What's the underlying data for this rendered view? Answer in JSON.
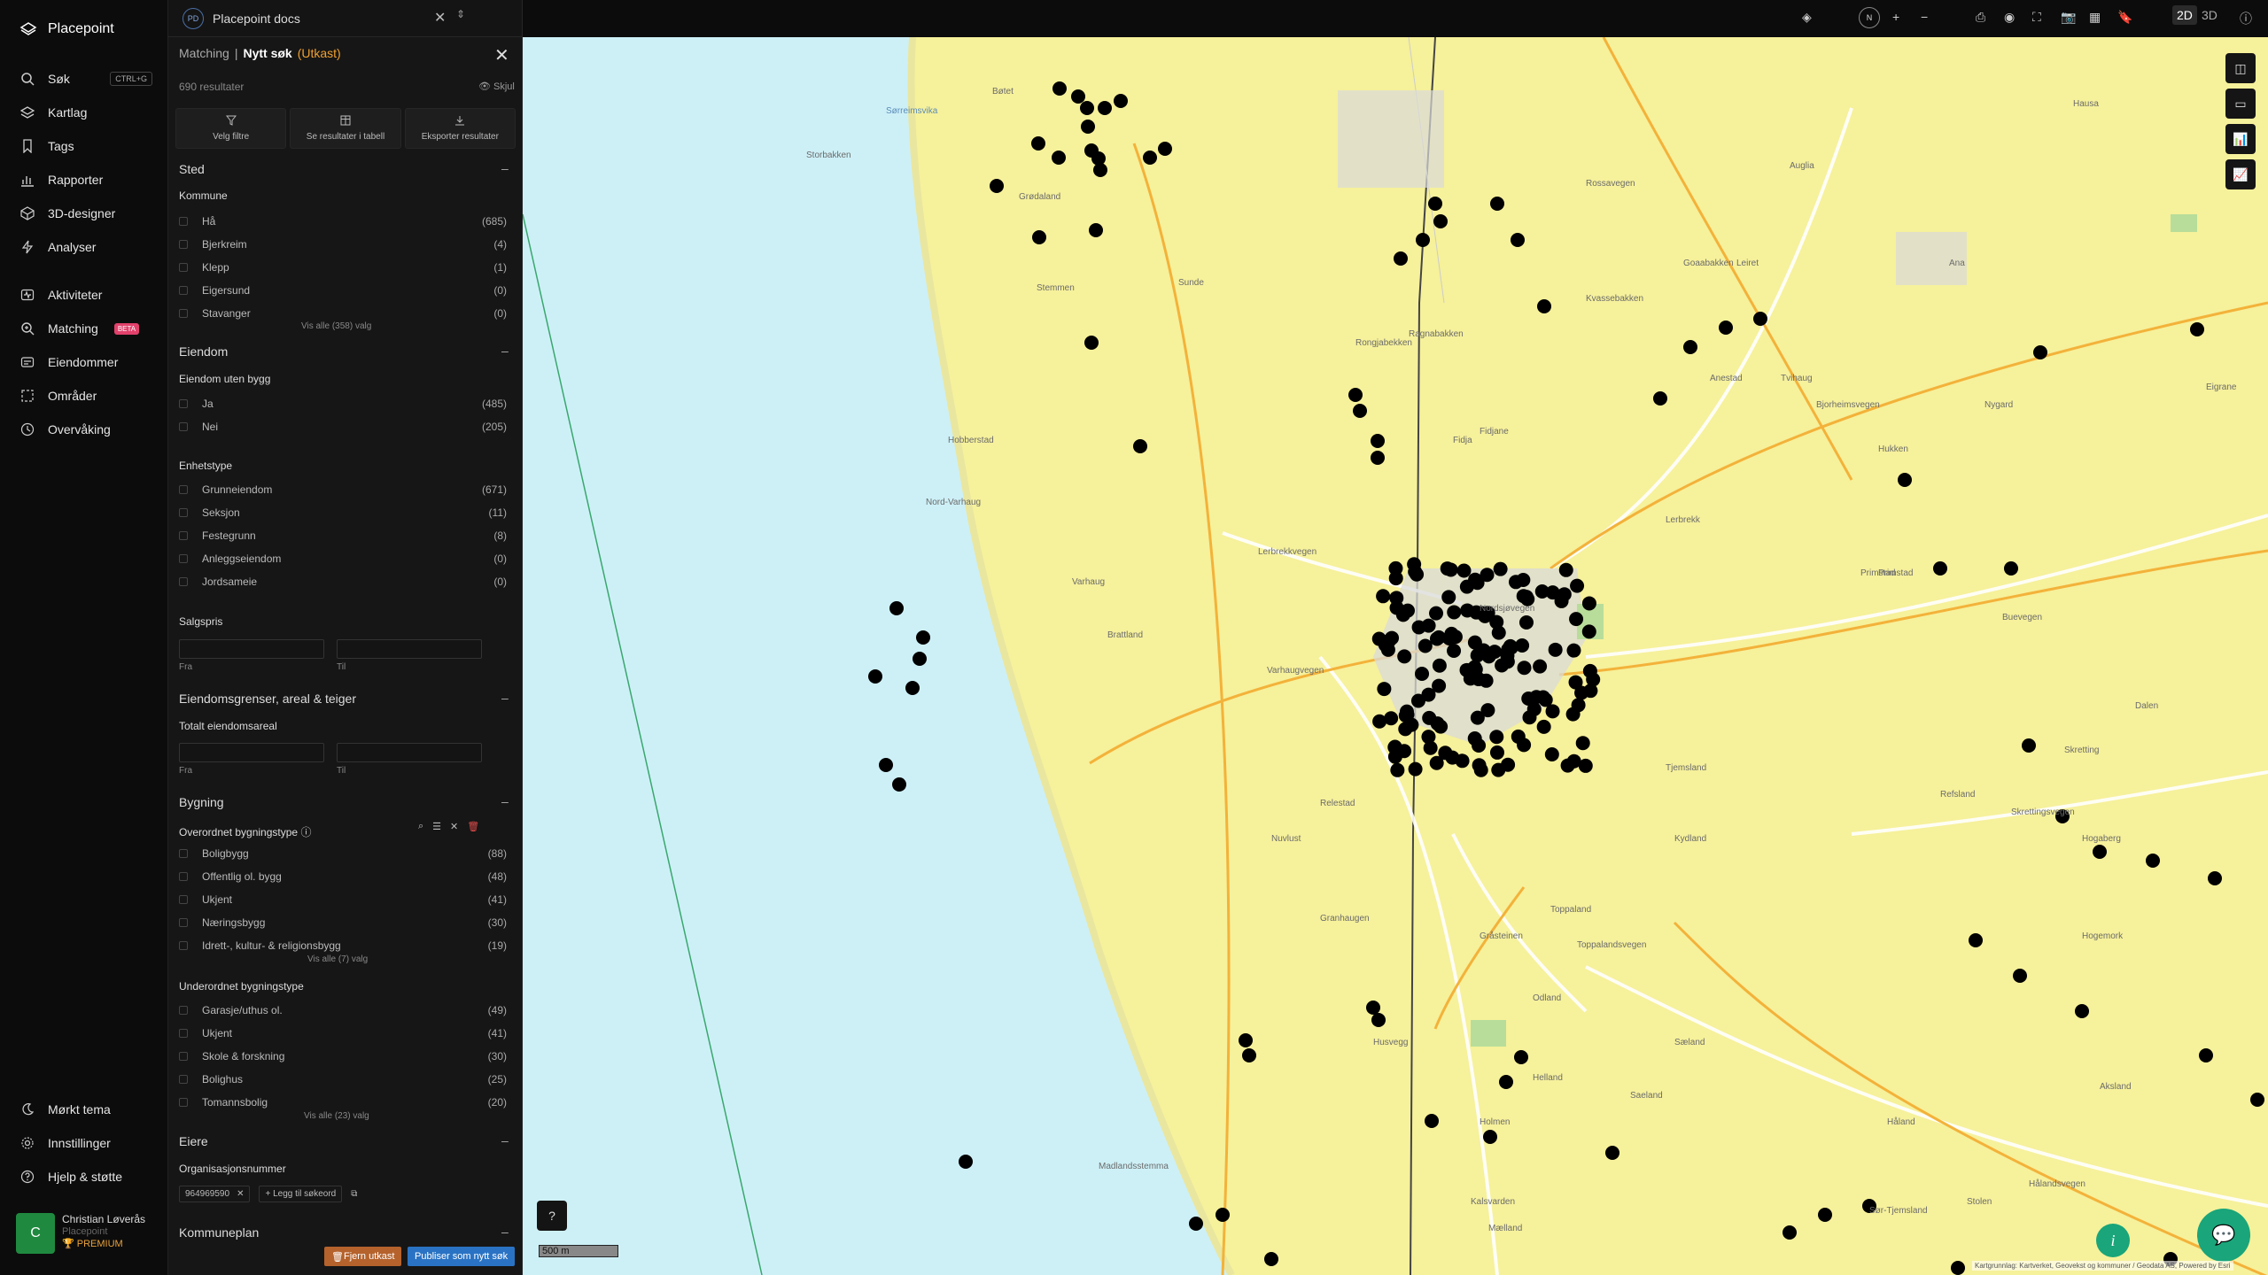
{
  "nav": {
    "brand": "Placepoint",
    "items": [
      {
        "label": "Søk",
        "icon": "search-icon",
        "shortcut": "CTRL+G"
      },
      {
        "label": "Kartlag",
        "icon": "layers-icon"
      },
      {
        "label": "Tags",
        "icon": "bookmark-icon"
      },
      {
        "label": "Rapporter",
        "icon": "bar-chart-icon"
      },
      {
        "label": "3D-designer",
        "icon": "cube-icon"
      },
      {
        "label": "Analyser",
        "icon": "bolt-icon"
      },
      {
        "label": "Aktiviteter",
        "icon": "activity-icon"
      },
      {
        "label": "Matching",
        "icon": "search-plus-icon",
        "badge": "BETA"
      },
      {
        "label": "Eiendommer",
        "icon": "building-icon"
      },
      {
        "label": "Områder",
        "icon": "area-icon"
      },
      {
        "label": "Overvåking",
        "icon": "clock-icon"
      },
      {
        "label": "Mørkt tema",
        "icon": "moon-icon"
      },
      {
        "label": "Innstillinger",
        "icon": "gear-icon"
      },
      {
        "label": "Hjelp & støtte",
        "icon": "help-icon"
      }
    ],
    "user": {
      "initial": "C",
      "name": "Christian Løverås",
      "org": "Placepoint",
      "plan": "PREMIUM"
    }
  },
  "tab": {
    "badge": "PD",
    "title": "Placepoint docs"
  },
  "panel": {
    "crumb_parent": "Matching",
    "crumb_sep": "|",
    "crumb_current": "Nytt søk",
    "crumb_status": "(Utkast)",
    "result_count": "690 resultater",
    "hide_label": "Skjul",
    "actions": [
      "Velg filtre",
      "Se resultater i tabell",
      "Eksporter resultater"
    ],
    "sections": {
      "sted": {
        "title": "Sted",
        "kommune_title": "Kommune",
        "kommune": [
          {
            "label": "Hå",
            "count": "(685)"
          },
          {
            "label": "Bjerkreim",
            "count": "(4)"
          },
          {
            "label": "Klepp",
            "count": "(1)"
          },
          {
            "label": "Eigersund",
            "count": "(0)"
          },
          {
            "label": "Stavanger",
            "count": "(0)"
          }
        ],
        "show_all": "Vis alle (358) valg"
      },
      "eiendom": {
        "title": "Eiendom",
        "uten_bygg_title": "Eiendom uten bygg",
        "uten_bygg": [
          {
            "label": "Ja",
            "count": "(485)"
          },
          {
            "label": "Nei",
            "count": "(205)"
          }
        ],
        "enhetstype_title": "Enhetstype",
        "enhetstype": [
          {
            "label": "Grunneiendom",
            "count": "(671)"
          },
          {
            "label": "Seksjon",
            "count": "(11)"
          },
          {
            "label": "Festegrunn",
            "count": "(8)"
          },
          {
            "label": "Anleggseiendom",
            "count": "(0)"
          },
          {
            "label": "Jordsameie",
            "count": "(0)"
          }
        ],
        "salgspris_title": "Salgspris",
        "from_label": "Fra",
        "to_label": "Til"
      },
      "grenser": {
        "title": "Eiendomsgrenser, areal & teiger",
        "areal_title": "Totalt eiendomsareal",
        "from_label": "Fra",
        "to_label": "Til"
      },
      "bygning": {
        "title": "Bygning",
        "overordnet_title": "Overordnet bygningstype",
        "overordnet": [
          {
            "label": "Boligbygg",
            "count": "(88)"
          },
          {
            "label": "Offentlig ol. bygg",
            "count": "(48)"
          },
          {
            "label": "Ukjent",
            "count": "(41)"
          },
          {
            "label": "Næringsbygg",
            "count": "(30)"
          },
          {
            "label": "Idrett-, kultur- & religionsbygg",
            "count": "(19)"
          }
        ],
        "overordnet_show_all": "Vis alle (7) valg",
        "underordnet_title": "Underordnet bygningstype",
        "underordnet": [
          {
            "label": "Garasje/uthus ol.",
            "count": "(49)"
          },
          {
            "label": "Ukjent",
            "count": "(41)"
          },
          {
            "label": "Skole & forskning",
            "count": "(30)"
          },
          {
            "label": "Bolighus",
            "count": "(25)"
          },
          {
            "label": "Tomannsbolig",
            "count": "(20)"
          }
        ],
        "underordnet_show_all": "Vis alle (23) valg"
      },
      "eiere": {
        "title": "Eiere",
        "org_title": "Organisasjonsnummer",
        "org_value": "964969590",
        "add_label": "Legg til søkeord"
      },
      "kommuneplan": {
        "title": "Kommuneplan"
      }
    },
    "remove_draft": "Fjern utkast",
    "publish": "Publiser som nytt søk"
  },
  "toolbar": {
    "compass": "N",
    "view_2d": "2D",
    "view_3d": "3D"
  },
  "map": {
    "scale": "500 m",
    "attribution": "Kartgrunnlag: Kartverket, Geovekst og kommuner / Geodata AS, Powered by Esri",
    "labels": [
      "Sørreimsvika",
      "Bøtet",
      "Storbakken",
      "Grødaland",
      "Stemmen",
      "Sunde",
      "Hobberstad",
      "Nord-Varhaug",
      "Varhaug",
      "Brattland",
      "Lerbrekkvegen",
      "Varhaugvegen",
      "Nordsjøvegen",
      "Rongjabekken",
      "Rossavegen",
      "Goaabakken",
      "Leiret",
      "Anestad",
      "Fidjane",
      "Kvassebakken",
      "Tvihaug",
      "Bjorheimsvegen",
      "Hukken",
      "Nygard",
      "Primstad",
      "Buevegen",
      "Dalen",
      "Skretting",
      "Refsland",
      "Skrettingsvegen",
      "Hogaberg",
      "Hogemork",
      "Tjemsland",
      "Kydland",
      "Granhaugen",
      "Toppaland",
      "Toppalandsvegen",
      "Gråsteinen",
      "Odland",
      "Husvegg",
      "Helland",
      "Sæland",
      "Holmen",
      "Mælland",
      "Kalsvarden",
      "Madlandsstemma",
      "Stolen",
      "Hålandsvegen",
      "Sør-Tjemsland",
      "Håland",
      "Aksland",
      "Ana",
      "Ragnabakken",
      "Hausa",
      "Primstad",
      "Lerbrekk",
      "Nuvlust",
      "Relestad",
      "Auglia",
      "Fidja",
      "Saeland",
      "Eigrane"
    ]
  },
  "colors": {
    "accent": "#e9a23b",
    "publish": "#2a73c4",
    "success": "#1aa57a",
    "map_land": "#f6f19b",
    "map_sea": "#cdf0f7"
  }
}
